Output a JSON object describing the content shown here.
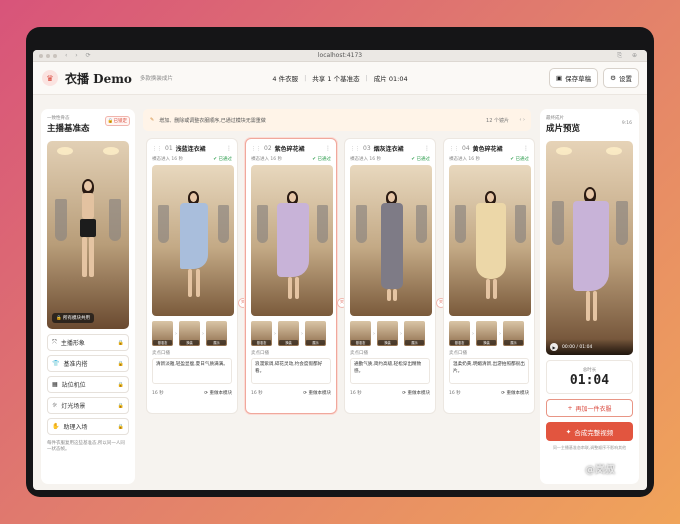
{
  "browser": {
    "url": "localhost:4173"
  },
  "app": {
    "title": "衣播 Demo",
    "subtitle": "多款换装成片",
    "stats": {
      "items": "4 件衣服",
      "shared": "共享 1 个基准态",
      "duration": "成片 01:04"
    },
    "save_label": "保存草稿",
    "settings_label": "设置"
  },
  "left": {
    "small": "一致性骨态",
    "title": "主播基准态",
    "lock_label": "已锁定",
    "photo_chip": "所有模块共用",
    "menu": [
      "主播形象",
      "基准内搭",
      "站位机位",
      "灯光场景",
      "助理入场"
    ],
    "note": "每件衣服复用这些基准态,所以同一人同一状态帧。"
  },
  "banner": {
    "text": "增加、删除或调整衣服顺序,已通过模块无需重做",
    "count": "12 个镜片"
  },
  "cards": [
    {
      "num": "01",
      "name": "浅蓝连衣裙",
      "meta": "裸态进入 16 秒",
      "status": "已通过",
      "thumbs": [
        "基准态",
        "换装",
        "展示"
      ],
      "label": "卖点口播",
      "desc": "清新淡雅,轻盈显瘦,夏日气质满满。",
      "dur": "16 秒",
      "regen": "重做本模块"
    },
    {
      "num": "02",
      "name": "紫色碎花裙",
      "meta": "裸态进入 16 秒",
      "status": "已通过",
      "thumbs": [
        "基准态",
        "换装",
        "展示"
      ],
      "label": "卖点口播",
      "desc": "浪漫紫调,碎花灵动,约会度假都好看。",
      "dur": "16 秒",
      "regen": "重做本模块"
    },
    {
      "num": "03",
      "name": "烟灰连衣裙",
      "meta": "裸态进入 16 秒",
      "status": "已通过",
      "thumbs": [
        "基准态",
        "换装",
        "展示"
      ],
      "label": "卖点口播",
      "desc": "通勤气质,简约高级,轻松穿出精致感。",
      "dur": "16 秒",
      "regen": "重做本模块"
    },
    {
      "num": "04",
      "name": "黄色碎花裙",
      "meta": "裸态进入 16 秒",
      "status": "已通过",
      "thumbs": [
        "基准态",
        "换装",
        "展示"
      ],
      "label": "卖点口播",
      "desc": "温柔奶黄,明媚清新,出游拍照都很出片。",
      "dur": "16 秒",
      "regen": "重做本模块"
    }
  ],
  "transition_label": "转场",
  "right": {
    "small": "最终成片",
    "title": "成片预览",
    "count": "9:16",
    "video_time": "00:00 / 01:04",
    "duration_label": "总时长",
    "duration": "01:04",
    "add_label": "再加一件衣服",
    "compose_label": "合成完整视频",
    "note": "同一主播基准态串联,调整顺序不影响其他"
  },
  "watermark": "@岚叔",
  "colors": {
    "accent": "#e2553f",
    "pass": "#2e9d4e",
    "dress": [
      "#a9bedc",
      "#c8b3d8",
      "#7e7b86",
      "#ecd7a8"
    ]
  }
}
